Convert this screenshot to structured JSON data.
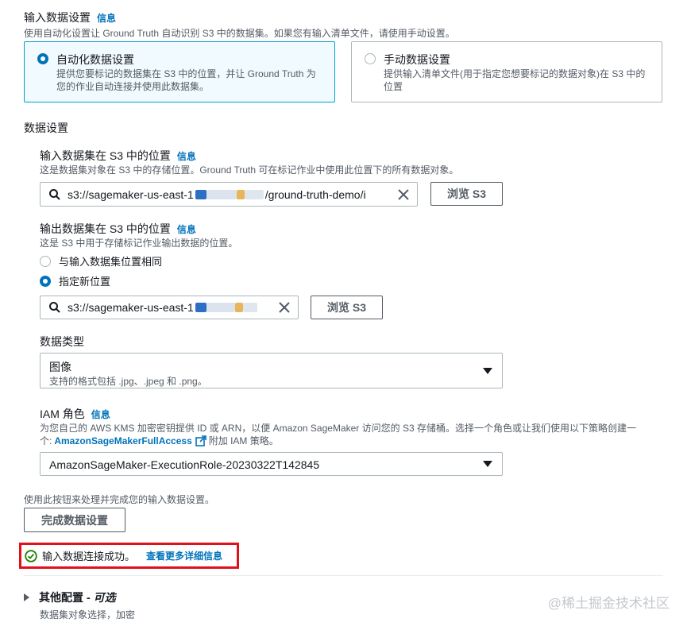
{
  "input_settings": {
    "title": "输入数据设置",
    "info": "信息",
    "desc": "使用自动化设置让 Ground Truth 自动识别 S3 中的数据集。如果您有输入清单文件，请使用手动设置。",
    "auto": {
      "label": "自动化数据设置",
      "desc1": "提供您要标记的数据集在 S3 中的位置，并让 Ground Truth 为",
      "desc2": "您的作业自动连接并使用此数据集。"
    },
    "manual": {
      "label": "手动数据设置",
      "desc1": "提供输入清单文件(用于指定您想要标记的数据对象)在 S3 中的",
      "desc2": "位置"
    }
  },
  "data_settings": {
    "title": "数据设置"
  },
  "input_location": {
    "title": "输入数据集在 S3 中的位置",
    "info": "信息",
    "desc": "这是数据集对象在 S3 中的存储位置。Ground Truth 可在标记作业中使用此位置下的所有数据对象。",
    "value_prefix": "s3://sagemaker-us-east-1",
    "value_suffix": "/ground-truth-demo/i",
    "browse": "浏览 S3"
  },
  "output_location": {
    "title": "输出数据集在 S3 中的位置",
    "info": "信息",
    "desc": "这是 S3 中用于存储标记作业输出数据的位置。",
    "option_same": "与输入数据集位置相同",
    "option_new": "指定新位置",
    "value_prefix": "s3://sagemaker-us-east-1",
    "browse": "浏览 S3"
  },
  "data_type": {
    "title": "数据类型",
    "selected": "图像",
    "selected_desc": "支持的格式包括 .jpg、.jpeg 和 .png。"
  },
  "iam_role": {
    "title": "IAM 角色",
    "info": "信息",
    "desc1": "为您自己的 AWS KMS 加密密钥提供 ID 或 ARN，以便 Amazon SageMaker 访问您的 S3 存储桶。选择一个角色或让我们使用以下策略创建一",
    "desc2_prefix": "个:",
    "policy_link": "AmazonSageMakerFullAccess",
    "desc2_suffix": "附加 IAM 策略。",
    "selected": "AmazonSageMaker-ExecutionRole-20230322T142845"
  },
  "complete": {
    "hint": "使用此按钮来处理并完成您的输入数据设置。",
    "button": "完成数据设置"
  },
  "status": {
    "message": "输入数据连接成功。",
    "link": "查看更多详细信息",
    "color": "#1d8102",
    "highlight_color": "#e0111b"
  },
  "other_config": {
    "title": "其他配置",
    "optional": "可选",
    "desc": "数据集对象选择，加密"
  },
  "watermark": "@稀土掘金技术社区"
}
